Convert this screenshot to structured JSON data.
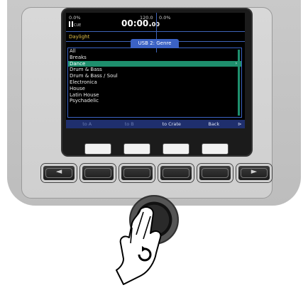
{
  "deck": {
    "pct_left": "0.0%",
    "cue_label": "CUE",
    "time_main": "00:00.",
    "time_frac": "00",
    "bpm": "120.0",
    "pct_right": "0.0%",
    "track": "Daylight"
  },
  "browser": {
    "tab_label": "USB 2: Genre",
    "items": [
      {
        "label": "All"
      },
      {
        "label": "Breaks"
      },
      {
        "label": "Dance"
      },
      {
        "label": "Drum & Bass"
      },
      {
        "label": "Drum & Bass / Soul"
      },
      {
        "label": "Electronica"
      },
      {
        "label": "House"
      },
      {
        "label": "Latin House"
      },
      {
        "label": "Psychadelic"
      }
    ],
    "selected_index": 2,
    "chevron": "›"
  },
  "softkeys": {
    "k1": "to A",
    "k2": "to B",
    "k3": "to Crate",
    "k4": "Back",
    "arrow": "⊳"
  },
  "buttons": {
    "left_arrow": "◄",
    "right_arrow": "►"
  }
}
